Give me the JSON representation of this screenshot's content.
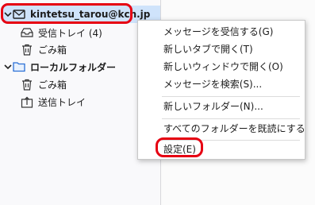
{
  "folder_pane": {
    "account": {
      "label": "kintetsu_tarou@kcn.jp",
      "icon": "mail-account-icon",
      "expanded": true
    },
    "account_folders": [
      {
        "label": "受信トレイ (4)",
        "icon": "inbox-icon"
      },
      {
        "label": "ごみ箱",
        "icon": "trash-icon"
      }
    ],
    "local": {
      "label": "ローカルフォルダー",
      "icon": "folder-icon",
      "expanded": true
    },
    "local_folders": [
      {
        "label": "ごみ箱",
        "icon": "trash-icon"
      },
      {
        "label": "送信トレイ",
        "icon": "outbox-icon"
      }
    ]
  },
  "context_menu": {
    "items": [
      "メッセージを受信する(G)",
      "新しいタブで開く(T)",
      "新しいウィンドウで開く(O)",
      "メッセージを検索(S)...",
      "新しいフォルダー(N)...",
      "すべてのフォルダーを既読にする",
      "設定(E)"
    ]
  },
  "colors": {
    "highlight": "#e60012",
    "selection": "#cfe3fb"
  }
}
